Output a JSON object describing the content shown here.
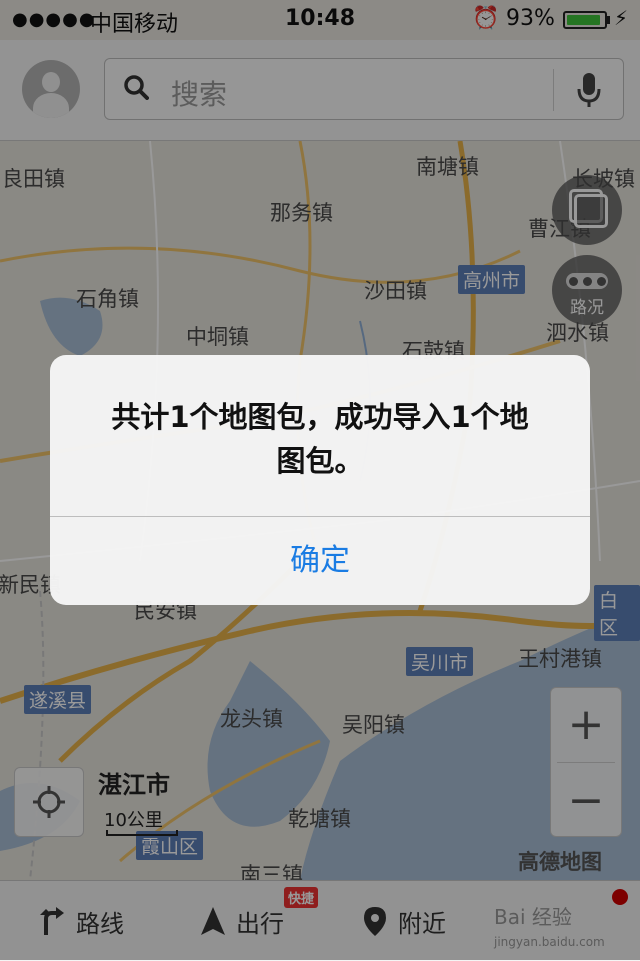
{
  "status_bar": {
    "signal": "●●●●●",
    "carrier": "中国移动",
    "time": "10:48",
    "battery_percent_text": "93%",
    "battery_level": 0.93,
    "icons": [
      "signal-icon",
      "alarm-icon",
      "battery-icon",
      "charging-bolt-icon"
    ]
  },
  "header": {
    "search_placeholder": "搜索"
  },
  "map": {
    "places": [
      {
        "id": "liangtian",
        "label": "良田镇"
      },
      {
        "id": "nafu",
        "label": "那务镇"
      },
      {
        "id": "nantang",
        "label": "南塘镇"
      },
      {
        "id": "changpo",
        "label": "长坡镇"
      },
      {
        "id": "caojiang",
        "label": "曹江镇"
      },
      {
        "id": "shijiao",
        "label": "石角镇"
      },
      {
        "id": "shatian",
        "label": "沙田镇"
      },
      {
        "id": "zhongdong",
        "label": "中垌镇"
      },
      {
        "id": "shigu",
        "label": "石鼓镇"
      },
      {
        "id": "sishui",
        "label": "泗水镇"
      },
      {
        "id": "xinmin",
        "label": "新民镇"
      },
      {
        "id": "minan",
        "label": "民安镇"
      },
      {
        "id": "wangcungang",
        "label": "王村港镇"
      },
      {
        "id": "longtou",
        "label": "龙头镇"
      },
      {
        "id": "wuyang",
        "label": "吴阳镇"
      },
      {
        "id": "qiantang",
        "label": "乾塘镇"
      },
      {
        "id": "nansan",
        "label": "南三镇"
      },
      {
        "id": "zhanjiang",
        "label": "湛江市"
      }
    ],
    "city_badges": [
      {
        "id": "gaozhou",
        "label": "高州市"
      },
      {
        "id": "wuchuan",
        "label": "吴川市"
      },
      {
        "id": "suixi",
        "label": "遂溪县"
      },
      {
        "id": "xiashan",
        "label": "霞山区"
      },
      {
        "id": "baiqu",
        "label": "白区"
      }
    ],
    "traffic_label": "路况",
    "zoom_in_label": "+",
    "zoom_out_label": "−",
    "scale_label": "10公里",
    "logo_text": "高德地图"
  },
  "tabbar": {
    "route_label": "路线",
    "travel_label": "出行",
    "travel_badge": "快捷",
    "nearby_label": "附近",
    "watermark": "Bai 经验",
    "watermark_url": "jingyan.baidu.com"
  },
  "alert": {
    "message_line1": "共计1个地图包，成功导入1个地",
    "message_line2": "图包。",
    "confirm_label": "确定",
    "accent_color": "#1a7ce3"
  }
}
